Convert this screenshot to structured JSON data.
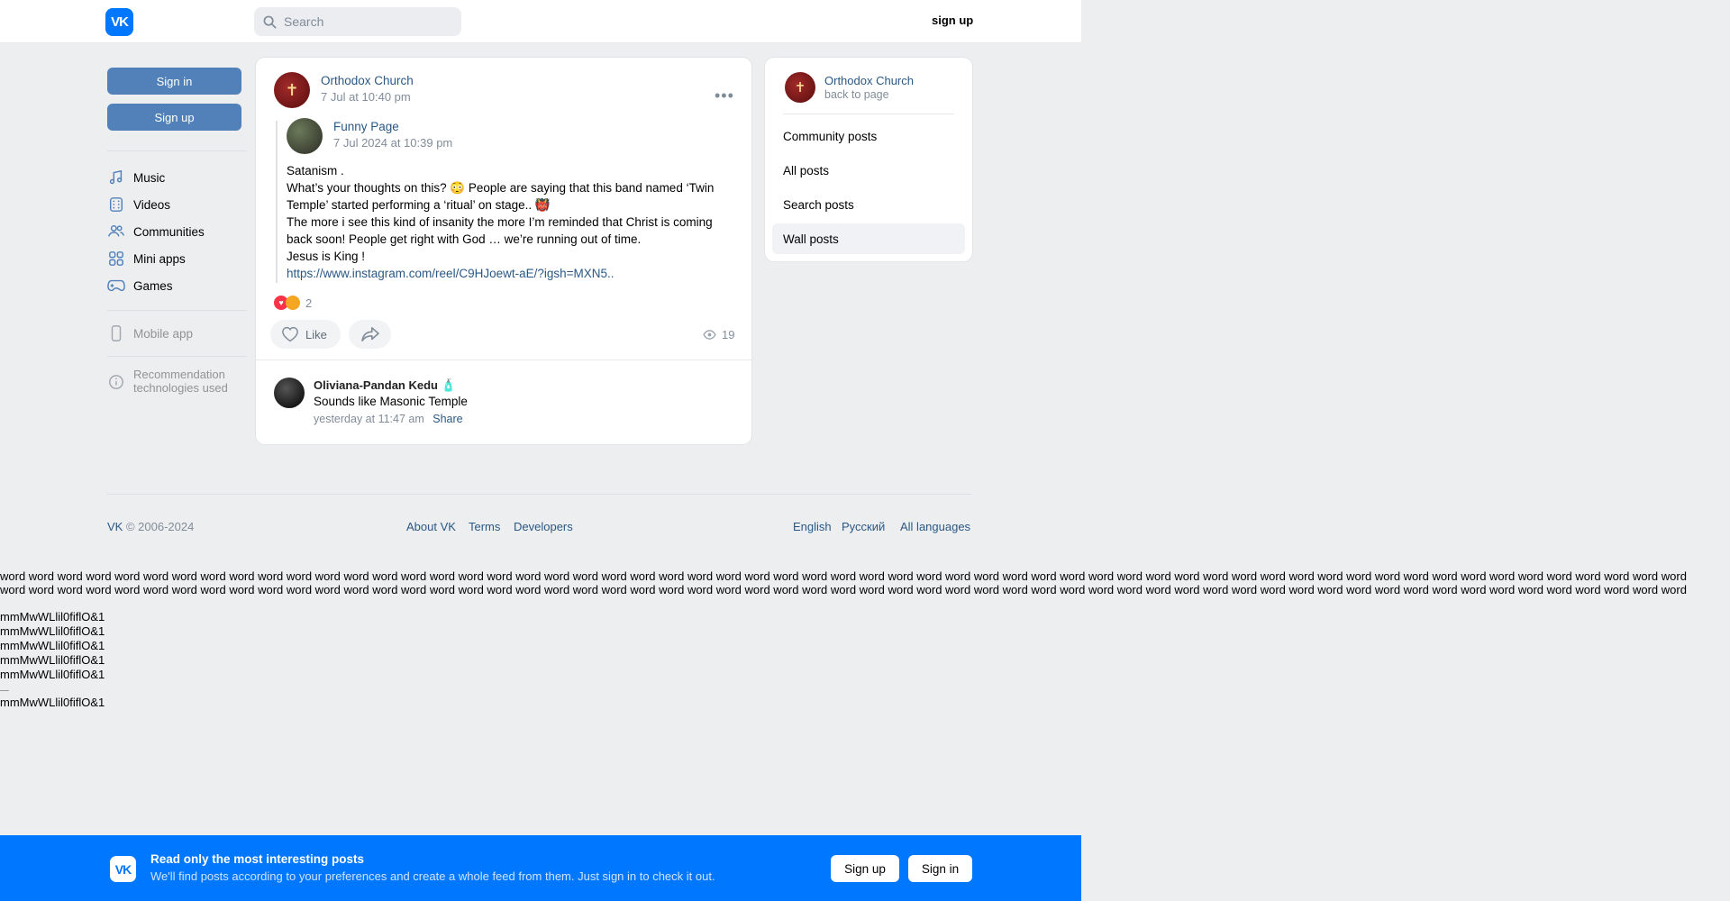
{
  "header": {
    "logo_text": "VK",
    "search_placeholder": "Search",
    "signup_label": "sign up"
  },
  "left_nav": {
    "signin_label": "Sign in",
    "signup_label": "Sign up",
    "items": [
      {
        "label": "Music",
        "icon": "music-icon"
      },
      {
        "label": "Videos",
        "icon": "video-icon"
      },
      {
        "label": "Communities",
        "icon": "users-icon"
      },
      {
        "label": "Mini apps",
        "icon": "apps-icon"
      },
      {
        "label": "Games",
        "icon": "gamepad-icon"
      }
    ],
    "mobile_app": "Mobile app",
    "recommendation_line1": "Recommendation",
    "recommendation_line2": "technologies used"
  },
  "post": {
    "author": "Orthodox Church",
    "date": "7 Jul at 10:40 pm",
    "repost_author": "Funny Page",
    "repost_date": "7 Jul 2024 at 10:39 pm",
    "lines": [
      "Satanism .",
      "What’s your thoughts on this? 😳 People are saying that this band named ‘Twin",
      "Temple’ started performing a ‘ritual’ on stage.. 👹",
      "The more i see this kind of insanity the more I’m reminded that Christ is coming",
      "back soon! People get right with God … we’re running out of time.",
      "Jesus is King !"
    ],
    "link": "https://www.instagram.com/reel/C9HJoewt-aE/?igsh=MXN5..",
    "reaction_count": "2",
    "like_label": "Like",
    "views": "19",
    "comment": {
      "author": "Oliviana-Pandan Kedu",
      "text": "Sounds like Masonic Temple",
      "time": "yesterday at 11:47 am",
      "share_label": "Share"
    }
  },
  "right_panel": {
    "name": "Orthodox Church",
    "back_label": "back to page",
    "items": [
      "Community posts",
      "All posts",
      "Search posts",
      "Wall posts"
    ],
    "active_item": "Wall posts"
  },
  "footer": {
    "copyright": "VK © 2006-2024",
    "about": "About VK",
    "terms": "Terms",
    "developers": "Developers",
    "english": "English",
    "russian": "Русский",
    "all_languages": "All languages"
  },
  "filler": {
    "word_line": "word word word word word word word word word word word word word word word word word word word word word word word word word word word word word word word word word word word word word word word word word word word word word word word word word word word word word word word word word word word",
    "mm_text": "mmMwWLlil0fiflO&1"
  },
  "banner": {
    "logo_text": "VK",
    "title": "Read only the most interesting posts",
    "subtitle": "We'll find posts according to your preferences and create a whole feed from them. Just sign in to check it out.",
    "signup_label": "Sign up",
    "signin_label": "Sign in"
  },
  "colors": {
    "accent": "#0077ff",
    "button_blue": "#5181b8",
    "link": "#2a5885",
    "background": "#edeef0"
  }
}
